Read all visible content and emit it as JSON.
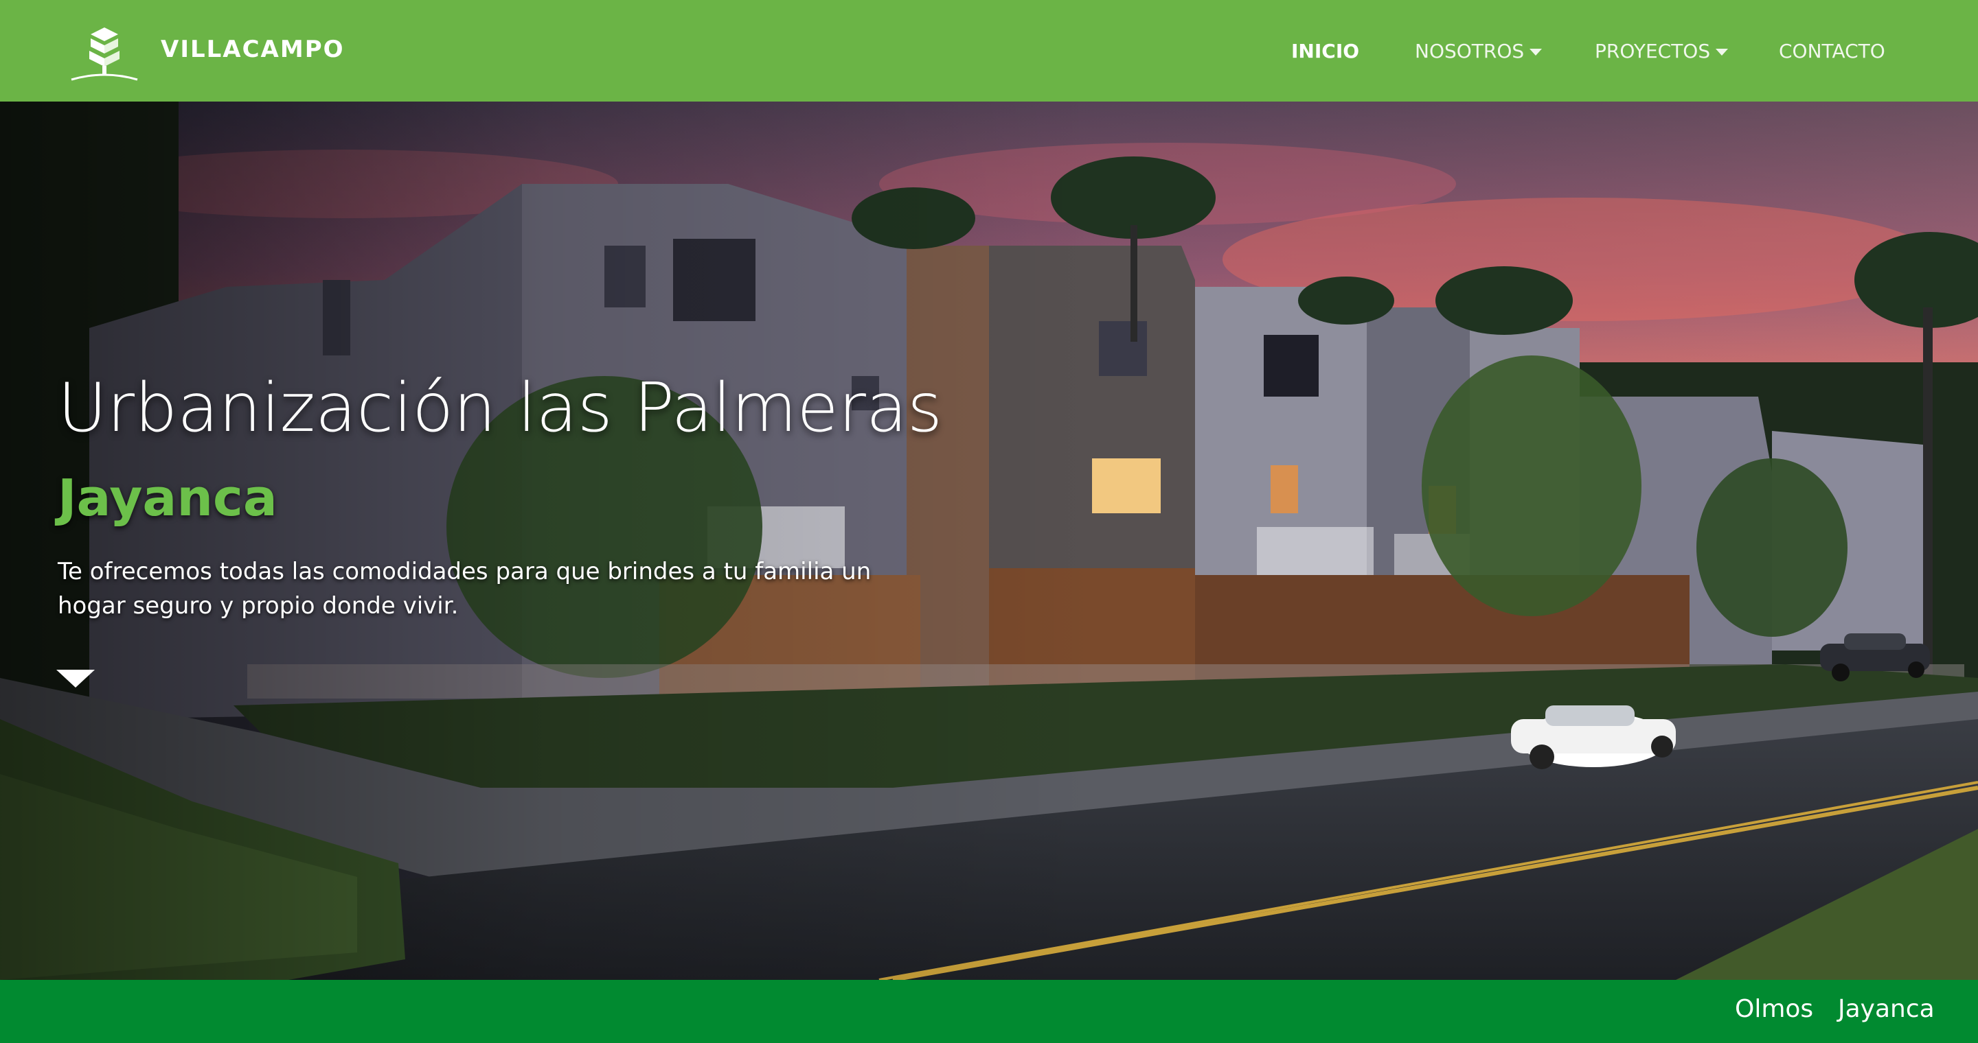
{
  "header": {
    "brand": "VILLACAMPO",
    "logo_icon": "tree-logo-icon",
    "nav": [
      {
        "label": "INICIO",
        "active": true,
        "dropdown": false
      },
      {
        "label": "NOSOTROS",
        "active": false,
        "dropdown": true
      },
      {
        "label": "PROYECTOS",
        "active": false,
        "dropdown": true
      },
      {
        "label": "CONTACTO",
        "active": false,
        "dropdown": false
      }
    ]
  },
  "hero": {
    "title": "Urbanización las Palmeras",
    "subtitle": "Jayanca",
    "description": "Te ofrecemos todas las comodidades para que brindes a tu familia un hogar seguro y propio donde vivir."
  },
  "bottom_bar": {
    "links": [
      "Olmos",
      "Jayanca"
    ]
  },
  "colors": {
    "header_bg": "#6bb446",
    "accent_green": "#6cc04a",
    "bottom_bar_bg": "#018a30"
  }
}
